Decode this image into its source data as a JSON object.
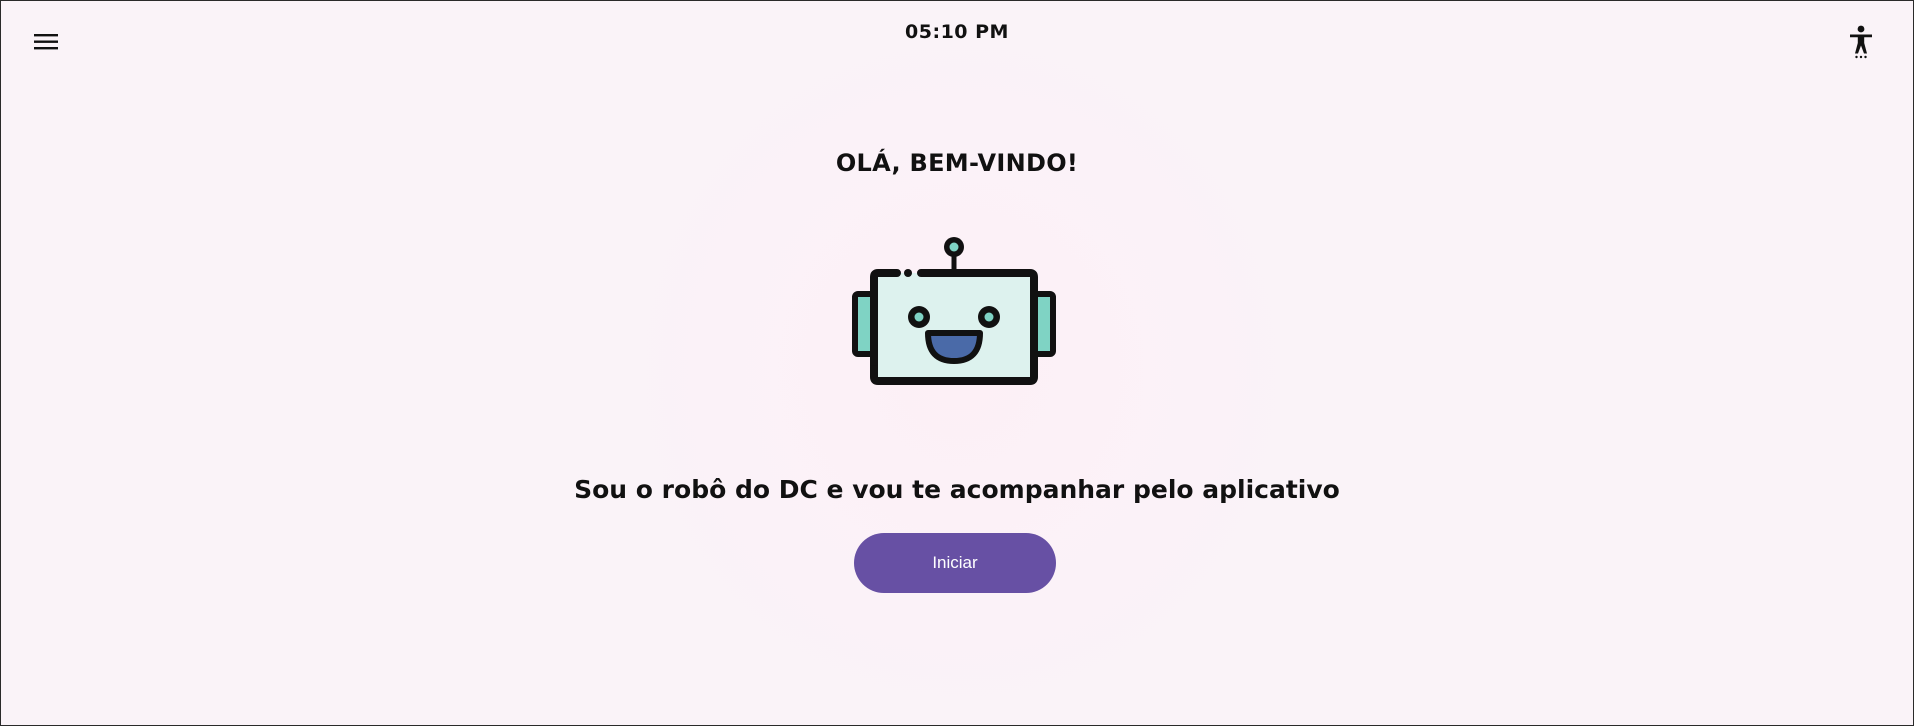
{
  "header": {
    "time": "05:10 PM",
    "menu_icon": "hamburger-menu-icon",
    "accessibility_icon": "accessibility-icon"
  },
  "main": {
    "welcome_title": "OLÁ, BEM-VINDO!",
    "mascot_icon": "robot-icon",
    "subtitle": "Sou o robô do DC e vou te acompanhar pelo aplicativo",
    "start_button_label": "Iniciar"
  },
  "colors": {
    "background": "#faf3f8",
    "primary": "#6750a4",
    "robot_face": "#ddf2ee",
    "robot_ears": "#7fd3c4",
    "robot_mouth": "#4a6aa8"
  }
}
